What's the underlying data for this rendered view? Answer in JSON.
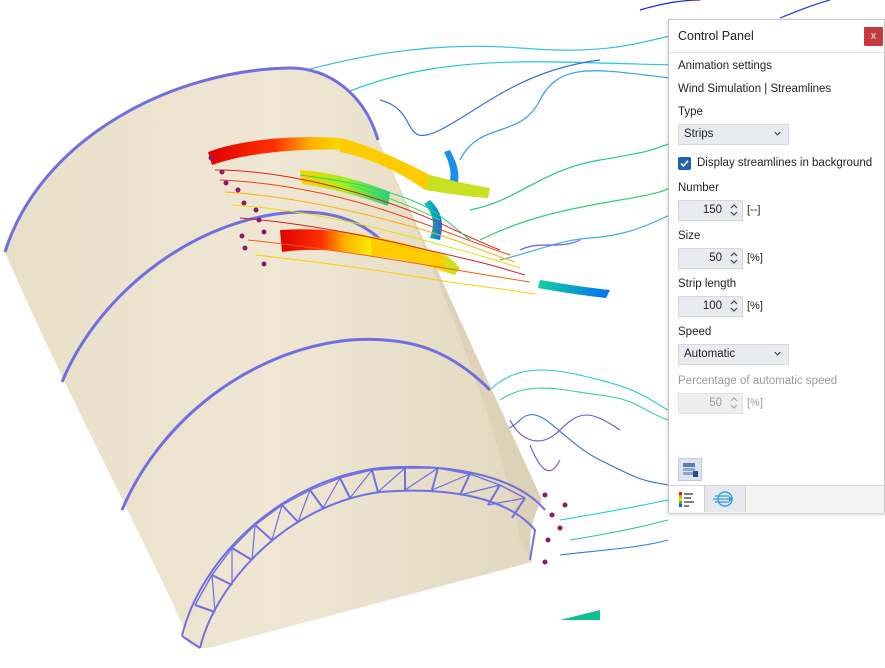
{
  "panel": {
    "title": "Control Panel",
    "close_label": "x",
    "section_title": "Animation settings",
    "subtitle": "Wind Simulation | Streamlines",
    "type": {
      "label": "Type",
      "value": "Strips"
    },
    "display_streamlines": {
      "label": "Display streamlines in background",
      "checked": true
    },
    "number": {
      "label": "Number",
      "value": "150",
      "unit": "[--]"
    },
    "size": {
      "label": "Size",
      "value": "50",
      "unit": "[%]"
    },
    "strip_length": {
      "label": "Strip length",
      "value": "100",
      "unit": "[%]"
    },
    "speed": {
      "label": "Speed",
      "value": "Automatic"
    },
    "percentage": {
      "label": "Percentage of automatic speed",
      "value": "50",
      "unit": "[%]",
      "enabled": false
    }
  },
  "colors": {
    "structure": "#6f6fe0",
    "surface": "#ece3cf",
    "accent": "#1e64b0",
    "close": "#c6393f",
    "pointer_arrow": "#1a3fd8"
  },
  "icons": [
    "close-icon",
    "chevron-down-icon",
    "spin-arrows-icon",
    "checkmark-icon",
    "results-table-icon",
    "color-scale-icon",
    "wind-animation-icon",
    "pointer-arrow-icon"
  ]
}
